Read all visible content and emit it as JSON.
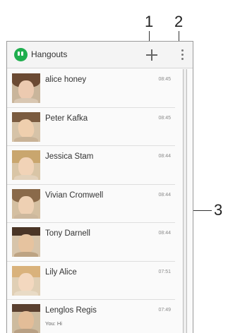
{
  "callouts": {
    "one": "1",
    "two": "2",
    "three": "3"
  },
  "header": {
    "title": "Hangouts",
    "logo_icon": "hangouts-logo-icon",
    "add_icon": "plus-icon",
    "menu_icon": "more-vert-icon"
  },
  "conversations": [
    {
      "name": "alice honey",
      "time": "08:45",
      "preview": ""
    },
    {
      "name": "Peter Kafka",
      "time": "08:45",
      "preview": ""
    },
    {
      "name": "Jessica Stam",
      "time": "08:44",
      "preview": ""
    },
    {
      "name": "Vivian Cromwell",
      "time": "08:44",
      "preview": ""
    },
    {
      "name": "Tony Darnell",
      "time": "08:44",
      "preview": ""
    },
    {
      "name": "Lily Alice",
      "time": "07:51",
      "preview": ""
    },
    {
      "name": "Lenglos Regis",
      "time": "07:49",
      "preview": "You: Hi"
    }
  ],
  "colors": {
    "brand": "#1fae4e",
    "callout_line": "#333333"
  }
}
